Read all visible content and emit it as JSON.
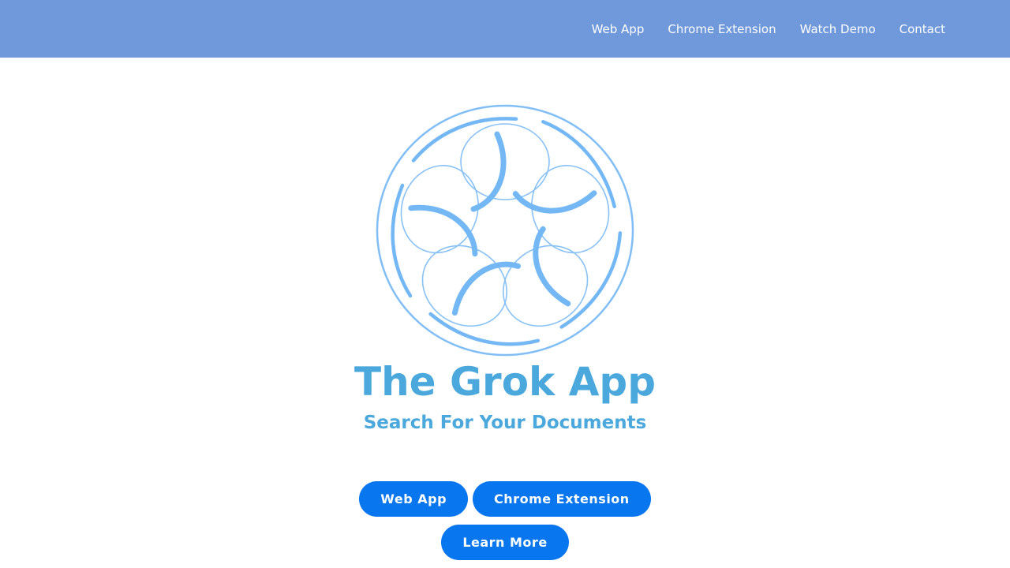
{
  "nav": {
    "items": [
      {
        "label": "Web App"
      },
      {
        "label": "Chrome Extension"
      },
      {
        "label": "Watch Demo"
      },
      {
        "label": "Contact"
      }
    ]
  },
  "hero": {
    "logo_icon": "swirl-circle-logo-icon",
    "title": "The Grok App",
    "subtitle": "Search For Your Documents",
    "buttons": {
      "web_app": "Web App",
      "chrome_extension": "Chrome Extension",
      "learn_more": "Learn More"
    }
  },
  "colors": {
    "navbar": "#6f99db",
    "heading": "#4aa8dc",
    "button": "#0876ef",
    "logo": "#74b7f5"
  }
}
